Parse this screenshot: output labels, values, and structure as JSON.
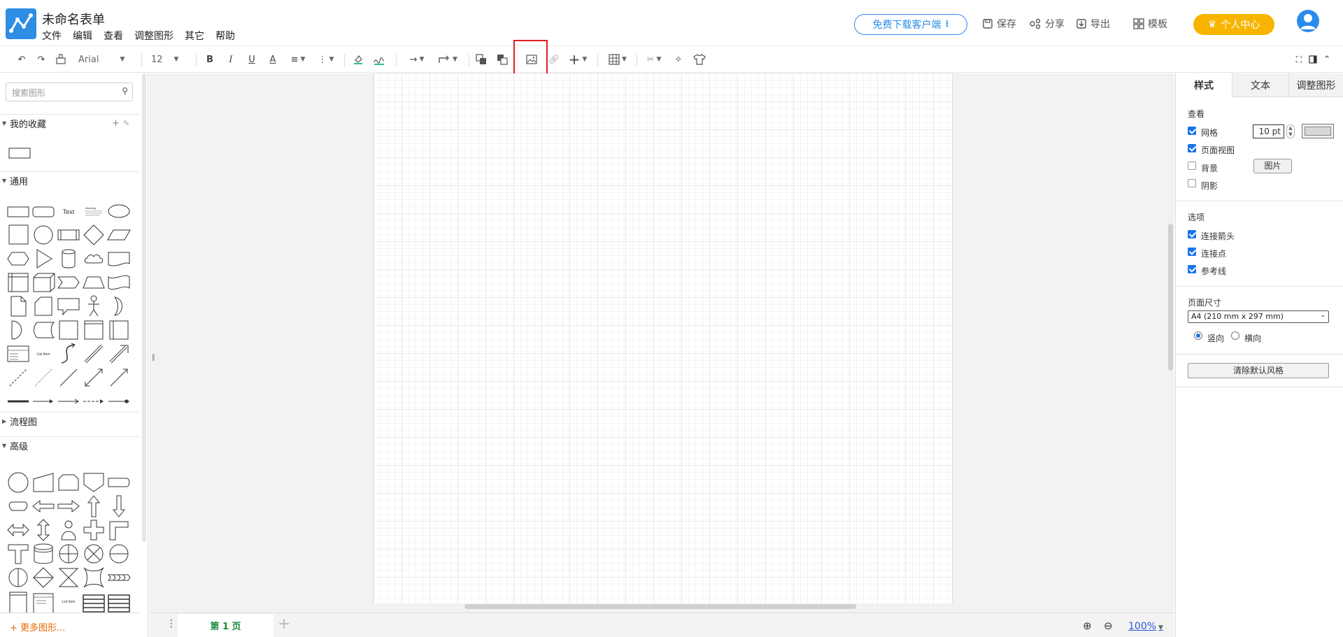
{
  "app": {
    "title": "未命名表单"
  },
  "menu": [
    "文件",
    "编辑",
    "查看",
    "调整图形",
    "其它",
    "帮助"
  ],
  "header": {
    "download_label": "免费下载客户端",
    "save_label": "保存",
    "share_label": "分享",
    "export_label": "导出",
    "template_label": "模板",
    "vip_label": "个人中心"
  },
  "toolbar": {
    "font_name": "Arial",
    "font_size": "12",
    "bold": "B",
    "italic": "I",
    "underline": "U",
    "font_color": "A"
  },
  "sidebar": {
    "search_placeholder": "搜索图形",
    "favorites_label": "我的收藏",
    "general_label": "通用",
    "flowchart_label": "流程图",
    "advanced_label": "高级",
    "more_shapes_label": "更多图形...",
    "shape_text_sample": "Text",
    "shape_heading_sample": "Heading",
    "shape_list_item_sample": "List Item"
  },
  "canvas": {
    "page_tab_label": "第 1 页",
    "zoom_label": "100%"
  },
  "right_panel": {
    "tabs": [
      "样式",
      "文本",
      "调整图形"
    ],
    "view_section": "查看",
    "grid_label": "网格",
    "grid_size": "10 pt",
    "page_view_label": "页面视图",
    "background_label": "背景",
    "image_button_label": "图片",
    "shadow_label": "阴影",
    "options_section": "选项",
    "connect_arrows_label": "连接箭头",
    "connect_points_label": "连接点",
    "guides_label": "参考线",
    "page_size_section": "页面尺寸",
    "page_size_value": "A4 (210 mm x 297 mm)",
    "portrait_label": "竖向",
    "landscape_label": "横向",
    "clear_style_label": "清除默认风格",
    "checked": {
      "grid": true,
      "page_view": true,
      "background": false,
      "shadow": false,
      "connect_arrows": true,
      "connect_points": true,
      "guides": true
    },
    "orientation": "portrait"
  },
  "colors": {
    "accent": "#2a8cea",
    "vip": "#f7b500",
    "highlight": "#e02020",
    "page_tab_text": "#1a8a3a"
  }
}
